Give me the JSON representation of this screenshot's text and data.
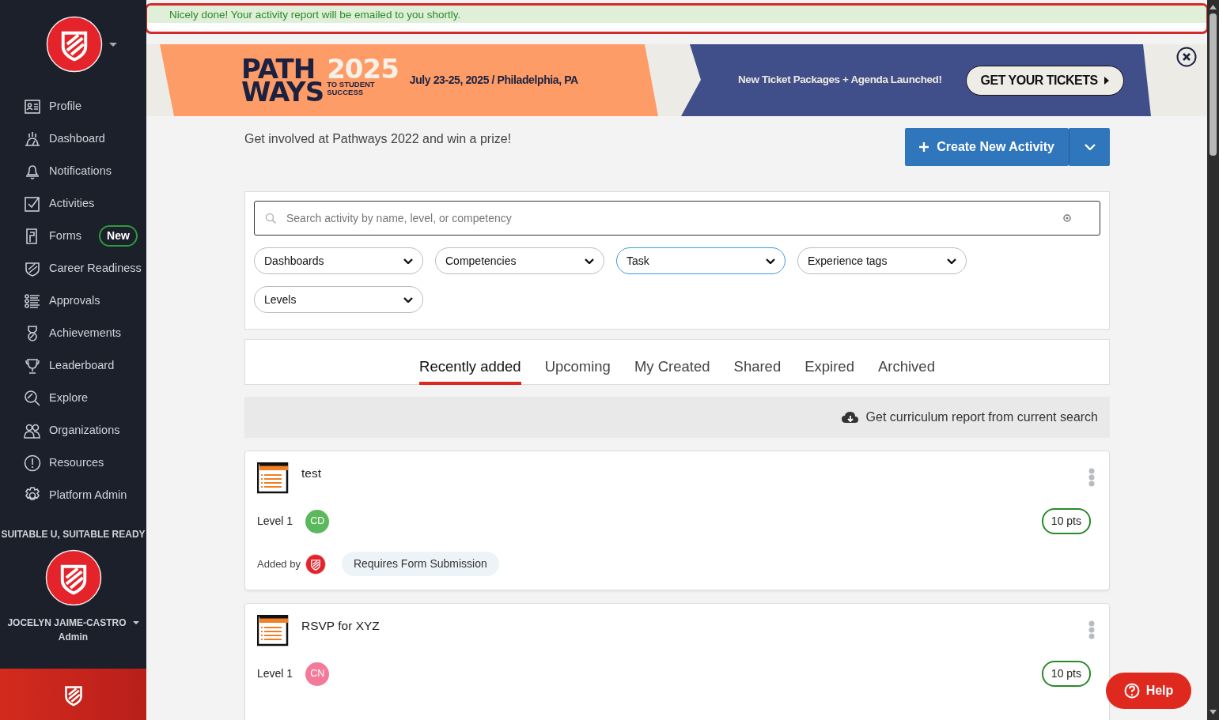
{
  "sidebar": {
    "items": [
      {
        "label": "Profile"
      },
      {
        "label": "Dashboard"
      },
      {
        "label": "Notifications"
      },
      {
        "label": "Activities"
      },
      {
        "label": "Forms",
        "badge": "New"
      },
      {
        "label": "Career Readiness"
      },
      {
        "label": "Approvals"
      },
      {
        "label": "Achievements"
      },
      {
        "label": "Leaderboard"
      },
      {
        "label": "Explore"
      },
      {
        "label": "Organizations"
      },
      {
        "label": "Resources"
      },
      {
        "label": "Platform Admin"
      }
    ],
    "org_name": "SUITABLE U, SUITABLE READY",
    "user_name": "JOCELYN JAIME-CASTRO",
    "user_role": "Admin"
  },
  "toast": {
    "message": "Nicely done! Your activity report will be emailed to you shortly."
  },
  "banner": {
    "logo_word_1": "PATH",
    "logo_word_2": "WAYS",
    "logo_year": "2025",
    "logo_tagline": "TO STUDENT SUCCESS",
    "dates": "July 23-25, 2025 / Philadelphia, PA",
    "announcement": "New Ticket Packages + Agenda Launched!",
    "cta": "GET YOUR TICKETS"
  },
  "intro": "Get involved at Pathways 2022 and win a prize!",
  "create_button": "Create New Activity",
  "search": {
    "placeholder": "Search activity by name, level, or competency"
  },
  "filters": [
    {
      "label": "Dashboards",
      "selected": false
    },
    {
      "label": "Competencies",
      "selected": false
    },
    {
      "label": "Task",
      "selected": true
    },
    {
      "label": "Experience tags",
      "selected": false
    },
    {
      "label": "Levels",
      "selected": false
    }
  ],
  "tabs": [
    {
      "label": "Recently added",
      "selected": true
    },
    {
      "label": "Upcoming",
      "selected": false
    },
    {
      "label": "My Created",
      "selected": false
    },
    {
      "label": "Shared",
      "selected": false
    },
    {
      "label": "Expired",
      "selected": false
    },
    {
      "label": "Archived",
      "selected": false
    }
  ],
  "report_link": "Get curriculum report from current search",
  "activities": [
    {
      "title": "test",
      "level": "Level 1",
      "competency": "CD",
      "color": "#5cb85c",
      "added_by": "Added by",
      "requirement": "Requires Form Submission",
      "points": "10 pts"
    },
    {
      "title": "RSVP for XYZ",
      "level": "Level 1",
      "competency": "CN",
      "color": "#f47a9a",
      "points": "10 pts"
    }
  ],
  "help_button": "Help"
}
